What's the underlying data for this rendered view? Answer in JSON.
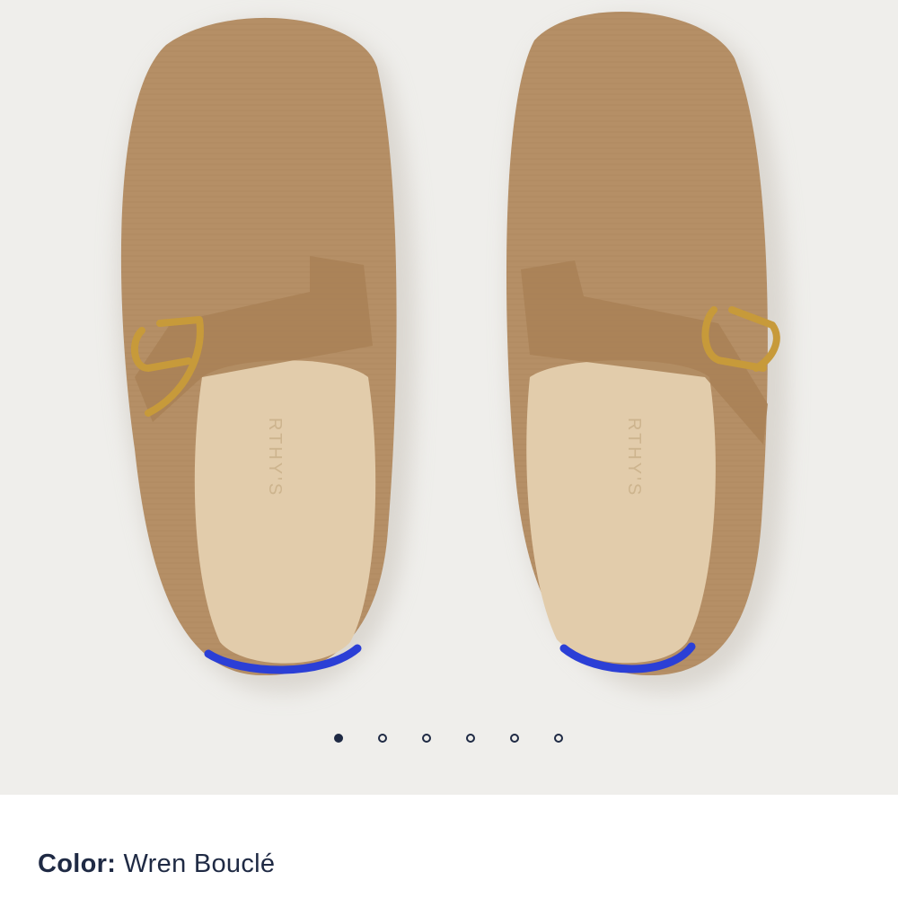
{
  "gallery": {
    "image_alt": "Product photo: pair of camel bouclé slip-on clogs with gold D-ring buckle straps",
    "insole_brand_text": "RTHY'S",
    "slide_count": 6,
    "active_slide": 1,
    "colors": {
      "background": "#efeeeb",
      "upper": "#b58f66",
      "insole": "#e2ccab",
      "buckle": "#c79a3a",
      "heel_stripe": "#2b3fd6",
      "dot": "#1f2a44"
    }
  },
  "product": {
    "color_label": "Color:",
    "color_value": "Wren Bouclé"
  }
}
